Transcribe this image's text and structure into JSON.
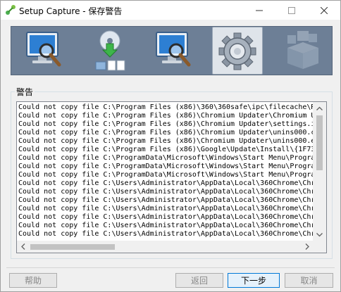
{
  "window": {
    "title": "Setup Capture - 保存警告"
  },
  "toolbar": {
    "steps": [
      {
        "icon": "monitor-magnifier-icon",
        "state": "inactive"
      },
      {
        "icon": "disc-install-icon",
        "state": "inactive"
      },
      {
        "icon": "monitor-magnifier-icon",
        "state": "inactive"
      },
      {
        "icon": "gear-icon",
        "state": "active"
      },
      {
        "icon": "package-boxes-icon",
        "state": "disabled"
      }
    ]
  },
  "warnings": {
    "label": "警告",
    "lines": [
      "Could not copy file C:\\Program Files (x86)\\360\\360safe\\ipc\\filecache\\R",
      "Could not copy file C:\\Program Files (x86)\\Chromium Updater\\Chromium U",
      "Could not copy file C:\\Program Files (x86)\\Chromium Updater\\settings.i",
      "Could not copy file C:\\Program Files (x86)\\Chromium Updater\\unins000.c",
      "Could not copy file C:\\Program Files (x86)\\Chromium Updater\\unins000.e",
      "Could not copy file C:\\Program Files (x86)\\Google\\Update\\Install\\{1F73",
      "Could not copy file C:\\ProgramData\\Microsoft\\Windows\\Start Menu\\Progra",
      "Could not copy file C:\\ProgramData\\Microsoft\\Windows\\Start Menu\\Progra",
      "Could not copy file C:\\ProgramData\\Microsoft\\Windows\\Start Menu\\Progra",
      "Could not copy file C:\\Users\\Administrator\\AppData\\Local\\360Chrome\\Chr",
      "Could not copy file C:\\Users\\Administrator\\AppData\\Local\\360Chrome\\Chr",
      "Could not copy file C:\\Users\\Administrator\\AppData\\Local\\360Chrome\\Chr",
      "Could not copy file C:\\Users\\Administrator\\AppData\\Local\\360Chrome\\Chr",
      "Could not copy file C:\\Users\\Administrator\\AppData\\Local\\360Chrome\\Chr",
      "Could not copy file C:\\Users\\Administrator\\AppData\\Local\\360Chrome\\Chr",
      "Could not copy file C:\\Users\\Administrator\\AppData\\Local\\360Chrome\\Chr"
    ]
  },
  "buttons": {
    "help": "帮助",
    "back": "返回",
    "next": "下一步",
    "cancel": "取消"
  }
}
